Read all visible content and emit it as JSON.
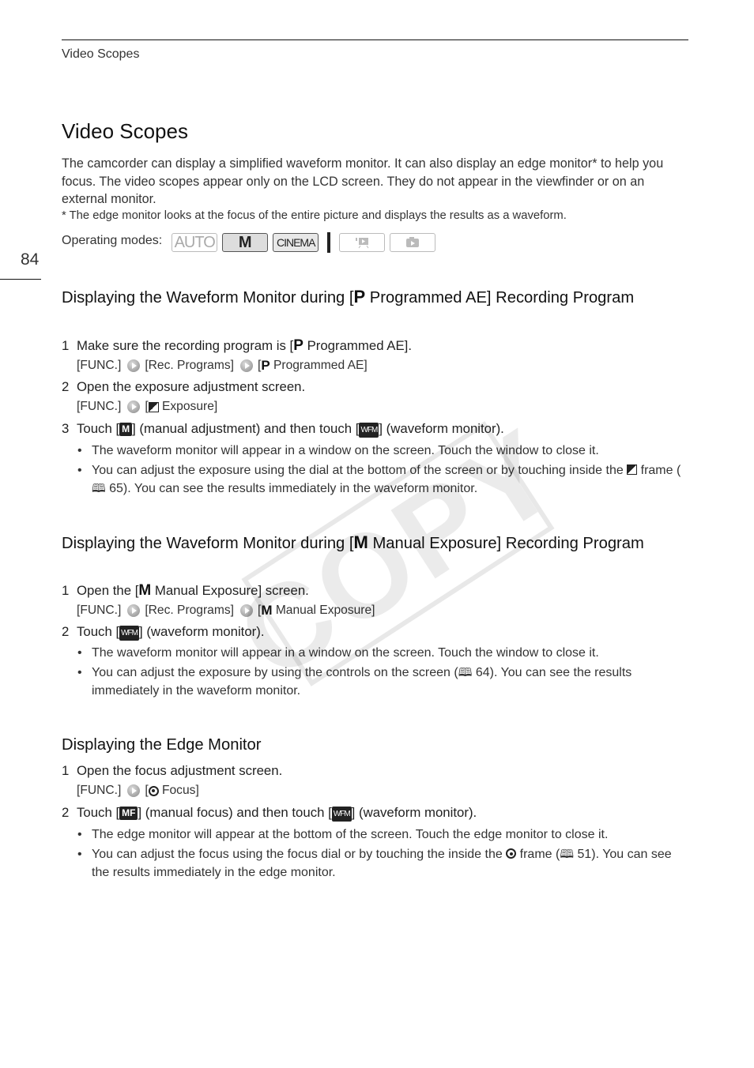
{
  "header": {
    "running_head": "Video Scopes",
    "page_number": "84"
  },
  "title": "Video Scopes",
  "intro": "The camcorder can display a simplified waveform monitor. It can also display an edge monitor* to help you focus. The video scopes appear only on the LCD screen. They do not appear in the viewfinder or on an external monitor.",
  "footnote": "*  The edge monitor looks at the focus of the entire picture and displays the results as a waveform.",
  "operating_modes": {
    "label": "Operating modes:",
    "modes": [
      {
        "label": "AUTO",
        "active": false
      },
      {
        "label": "M",
        "active": true
      },
      {
        "label": "CINEMA",
        "active": true
      },
      {
        "label": "video-playback-icon",
        "active": false
      },
      {
        "label": "photo-playback-icon",
        "active": false
      }
    ]
  },
  "sections": [
    {
      "heading_pre": "Displaying the Waveform Monitor during [",
      "heading_sym": "P",
      "heading_post": " Programmed AE] Recording Program",
      "steps": [
        {
          "num": "1",
          "pre": "Make sure the recording program is [",
          "sym": "P",
          "post": " Programmed AE].",
          "path": [
            "[FUNC.]",
            "[Rec. Programs]",
            "[",
            "P",
            " Programmed AE]"
          ]
        },
        {
          "num": "2",
          "text": "Open the exposure adjustment screen.",
          "path": [
            "[FUNC.]",
            "[",
            " Exposure]"
          ]
        },
        {
          "num": "3",
          "pre": "Touch [",
          "chip1": "M",
          "mid": "] (manual adjustment) and then touch [",
          "chip2": "WFM",
          "post": "] (waveform monitor)."
        }
      ],
      "bullets": [
        "The waveform monitor will appear in a window on the screen. Touch the window to close it.",
        {
          "pre": "You can adjust the exposure using the dial at the bottom of the screen or by touching inside the ",
          "post": " frame (",
          "ref": " 65). You can see the results immediately in the waveform monitor."
        }
      ]
    },
    {
      "heading_pre": "Displaying the Waveform Monitor during [",
      "heading_sym": "M",
      "heading_post": " Manual Exposure] Recording Program",
      "steps": [
        {
          "num": "1",
          "pre": "Open the [",
          "sym": "M",
          "post": " Manual Exposure] screen.",
          "path": [
            "[FUNC.]",
            "[Rec. Programs]",
            "[",
            "M",
            " Manual Exposure]"
          ]
        },
        {
          "num": "2",
          "pre": "Touch [",
          "chip": "WFM",
          "post": "] (waveform monitor)."
        }
      ],
      "bullets": [
        "The waveform monitor will appear in a window on the screen. Touch the window to close it.",
        {
          "pre": "You can adjust the exposure by using the controls on the screen (",
          "ref": " 64). You can see the results immediately in the waveform monitor."
        }
      ]
    },
    {
      "heading": "Displaying the Edge Monitor",
      "steps": [
        {
          "num": "1",
          "text": "Open the focus adjustment screen.",
          "path": [
            "[FUNC.]",
            "[",
            " Focus]"
          ]
        },
        {
          "num": "2",
          "pre": "Touch [",
          "chip1": "MF",
          "mid": "] (manual focus) and then touch [",
          "chip2": "WFM",
          "post": "] (waveform monitor)."
        }
      ],
      "bullets": [
        "The edge monitor will appear at the bottom of the screen. Touch the edge monitor to close it.",
        {
          "pre": "You can adjust the focus using the focus dial or by touching the inside the ",
          "post": " frame (",
          "ref": " 51). You can see the results immediately in the edge monitor."
        }
      ]
    }
  ],
  "watermark": "COPY"
}
